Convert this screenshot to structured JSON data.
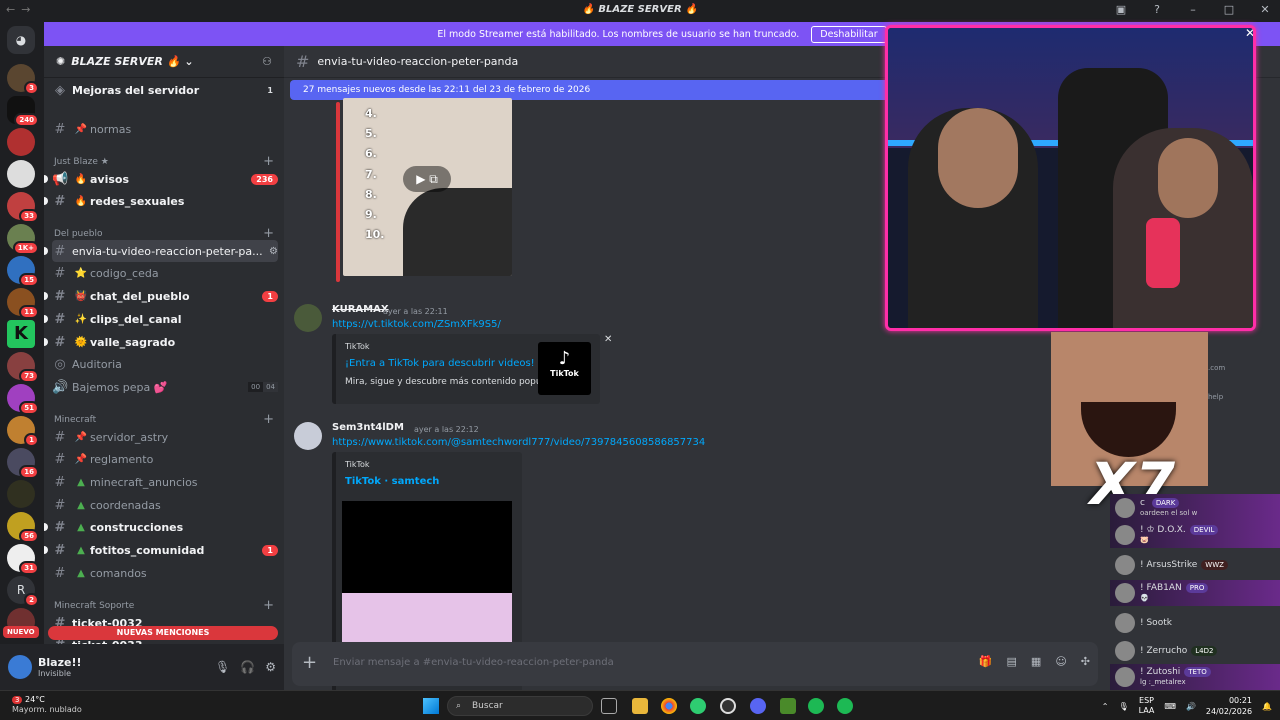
{
  "window": {
    "title": "🔥 BLAZE SERVER 🔥"
  },
  "guild_badges": [
    "3",
    "240",
    "",
    "",
    "",
    "33",
    "1K+",
    "15",
    "11",
    "",
    "73",
    "51",
    "1",
    "16",
    "",
    "56",
    "31",
    "2",
    ""
  ],
  "nuevo_label": "NUEVO",
  "streamer": {
    "text": "El modo Streamer está habilitado. Los nombres de usuario se han truncado.",
    "button": "Deshabilitar"
  },
  "server": {
    "name": "BLAZE SERVER 🔥"
  },
  "sidebar": {
    "boost": {
      "label": "Mejoras del servidor",
      "count": "1"
    },
    "normas": "normas",
    "cat_just": "Just Blaze ★",
    "avisos": {
      "label": "avisos",
      "count": "236"
    },
    "redes": "redes_sexuales",
    "cat_pueblo": "Del pueblo",
    "active": "envia-tu-video-reaccion-peter-pa...",
    "codigo": "codigo_ceda",
    "chat_pueblo": {
      "label": "chat_del_pueblo",
      "count": "1"
    },
    "clips": "clips_del_canal",
    "valle": "valle_sagrado",
    "auditoria": "Auditoria",
    "bajemos": {
      "label": "Bajemos pepa 💕",
      "a": "00",
      "b": "04"
    },
    "cat_minecraft": "Minecraft",
    "astry": "servidor_astry",
    "reglamento": "reglamento",
    "mc_anuncios": "minecraft_anuncios",
    "coordenadas": "coordenadas",
    "construcciones": "construcciones",
    "fotitos": {
      "label": "fotitos_comunidad",
      "count": "1"
    },
    "comandos": "comandos",
    "cat_soporte": "Minecraft Soporte",
    "ticket1": "ticket-0032",
    "ticket2": "ticket-0033",
    "new_mentions": "NUEVAS MENCIONES"
  },
  "user": {
    "name": "Blaze!!",
    "status": "Invisible"
  },
  "channel": {
    "name": "envia-tu-video-reaccion-peter-panda"
  },
  "new_messages": "27 mensajes nuevos desde las 22:11 del 23 de febrero de 2026",
  "video1_numbers": [
    "4.",
    "5.",
    "6.",
    "7.",
    "8.",
    "9.",
    "10."
  ],
  "msg1": {
    "user": "KURAMAX",
    "time": "ayer a las 22:11",
    "link": "https://vt.tiktok.com/ZSmXFk9S5/",
    "provider": "TikTok",
    "title": "¡Entra a TikTok para descubrir videos!",
    "desc": "Mira, sigue y descubre más contenido popular.",
    "thumb": "TikTok"
  },
  "msg2": {
    "user": "Sem3nt4lDM",
    "time": "ayer a las 22:12",
    "link": "https://www.tiktok.com/@samtechwordl777/video/7397845608586857734",
    "provider": "TikTok",
    "title": "TikTok · samtech"
  },
  "composer": {
    "placeholder": "Enviar mensaje a #envia-tu-video-reaccion-peter-panda"
  },
  "overlay": {
    "x7": "X7",
    "side1": ".com",
    "side2": "help"
  },
  "chat": [
    {
      "name": "c",
      "badge": "DARK",
      "sub": "oardeen el sol w"
    },
    {
      "name": "! ♔ D.O.X.",
      "badge": "DEVIL",
      "sub": "🐷"
    },
    {
      "name": "! ArsusStrike",
      "badge": "WWZ",
      "sub": ""
    },
    {
      "name": "! FAB1AN",
      "badge": "PRO",
      "sub": "💀"
    },
    {
      "name": "! Sootk",
      "badge": "",
      "sub": ""
    },
    {
      "name": "! Zerrucho",
      "badge": "L4D2",
      "sub": ""
    },
    {
      "name": "! Zutoshi",
      "badge": "TETO",
      "sub": "lg :_metalrex"
    }
  ],
  "taskbar": {
    "weather_badge": "3",
    "temp": "24°C",
    "weather": "Mayorm. nublado",
    "search": "Buscar",
    "lang1": "ESP",
    "lang2": "LAA",
    "time": "00:21",
    "date": "24/02/2026"
  }
}
